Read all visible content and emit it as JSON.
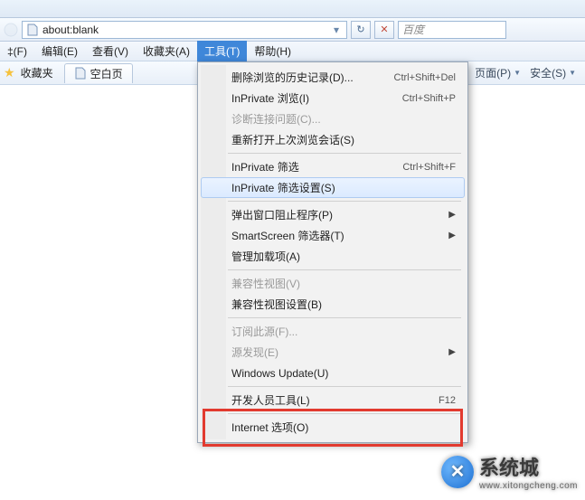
{
  "address_bar": {
    "url": "about:blank",
    "refresh_glyph": "↻",
    "stop_glyph": "✕",
    "search_placeholder": "百度"
  },
  "menubar": {
    "items": [
      {
        "label": "‡(F)"
      },
      {
        "label": "编辑(E)"
      },
      {
        "label": "查看(V)"
      },
      {
        "label": "收藏夹(A)"
      },
      {
        "label": "工具(T)"
      },
      {
        "label": "帮助(H)"
      }
    ],
    "active_index": 4
  },
  "favbar": {
    "label": "收藏夹",
    "tab_title": "空白页",
    "right": [
      {
        "label": "页面(P)"
      },
      {
        "label": "安全(S)"
      }
    ]
  },
  "tools_menu": {
    "groups": [
      [
        {
          "label": "删除浏览的历史记录(D)...",
          "shortcut": "Ctrl+Shift+Del"
        },
        {
          "label": "InPrivate 浏览(I)",
          "shortcut": "Ctrl+Shift+P"
        },
        {
          "label": "诊断连接问题(C)...",
          "disabled": true
        },
        {
          "label": "重新打开上次浏览会话(S)"
        }
      ],
      [
        {
          "label": "InPrivate 筛选",
          "shortcut": "Ctrl+Shift+F"
        },
        {
          "label": "InPrivate 筛选设置(S)",
          "hover": true
        }
      ],
      [
        {
          "label": "弹出窗口阻止程序(P)",
          "submenu": true
        },
        {
          "label": "SmartScreen 筛选器(T)",
          "submenu": true
        },
        {
          "label": "管理加载项(A)"
        }
      ],
      [
        {
          "label": "兼容性视图(V)",
          "disabled": true
        },
        {
          "label": "兼容性视图设置(B)"
        }
      ],
      [
        {
          "label": "订阅此源(F)...",
          "disabled": true
        },
        {
          "label": "源发现(E)",
          "submenu": true,
          "disabled": true
        },
        {
          "label": "Windows Update(U)"
        }
      ],
      [
        {
          "label": "开发人员工具(L)",
          "shortcut": "F12"
        }
      ],
      [
        {
          "label": "Internet 选项(O)"
        }
      ]
    ]
  },
  "watermark": {
    "badge": "✕",
    "cn": "系统城",
    "en": "www.xitongcheng.com"
  }
}
